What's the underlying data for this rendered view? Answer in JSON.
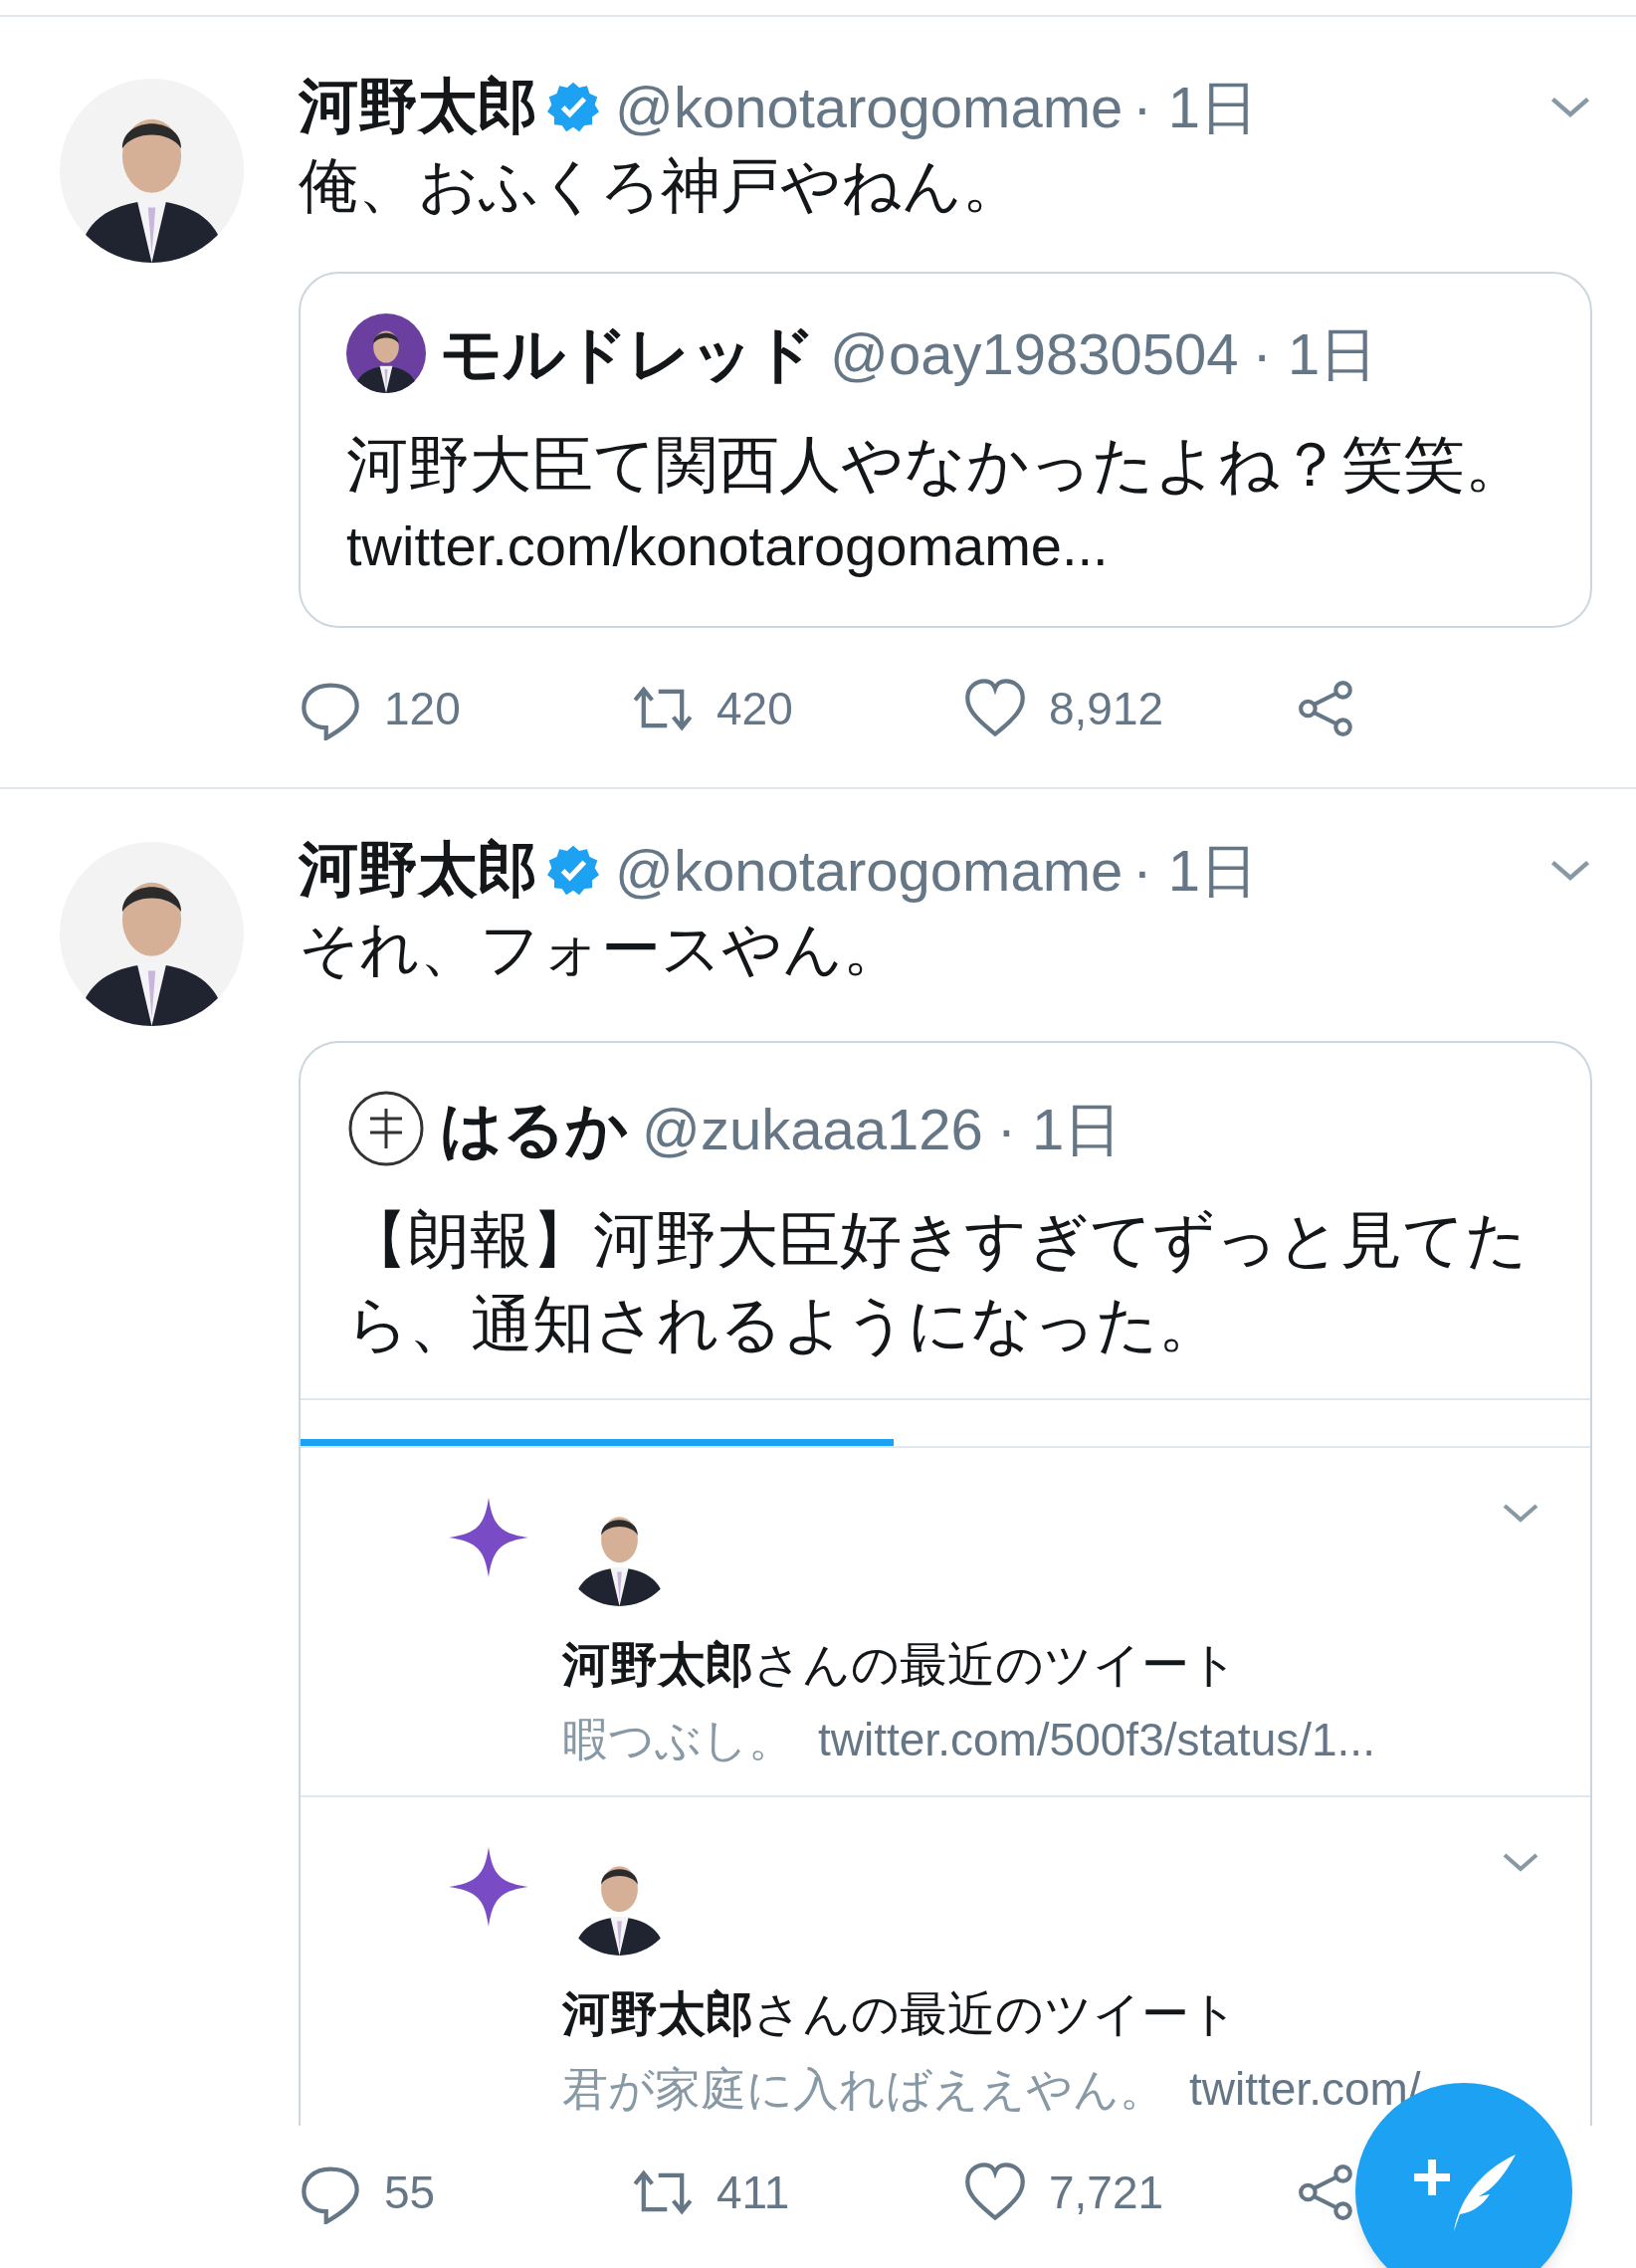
{
  "tweets": [
    {
      "author": "河野太郎",
      "verified": true,
      "handle": "@konotarogomame",
      "time": "· 1日",
      "text": "俺、おふくろ神戸やねん。",
      "quote": {
        "author": "モルドレッド",
        "handle": "@oay19830504",
        "time": "· 1日",
        "text": "河野大臣て関西人やなかったよね？笑笑。",
        "link": "twitter.com/konotarogomame..."
      },
      "replies": "120",
      "retweets": "420",
      "likes": "8,912"
    },
    {
      "author": "河野太郎",
      "verified": true,
      "handle": "@konotarogomame",
      "time": "· 1日",
      "text": "それ、フォースやん。",
      "quote": {
        "author": "はるか",
        "handle": "@zukaaa126",
        "time": "· 1日",
        "text": "【朗報】河野大臣好きすぎてずっと見てたら、通知されるようになった。",
        "media": {
          "progress": {
            "level": 0.46
          },
          "notifications": [
            {
              "title": "**河野太郎**さんの最近のツイート",
              "preview": "暇つぶし。",
              "link": "twitter.com/500f3/status/1..."
            },
            {
              "title": "**河野太郎**さんの最近のツイート",
              "preview": "君が家庭に入ればええやん。",
              "link": "twitter.com/"
            }
          ]
        }
      },
      "replies": "55",
      "retweets": "411",
      "likes": "7,721"
    }
  ]
}
